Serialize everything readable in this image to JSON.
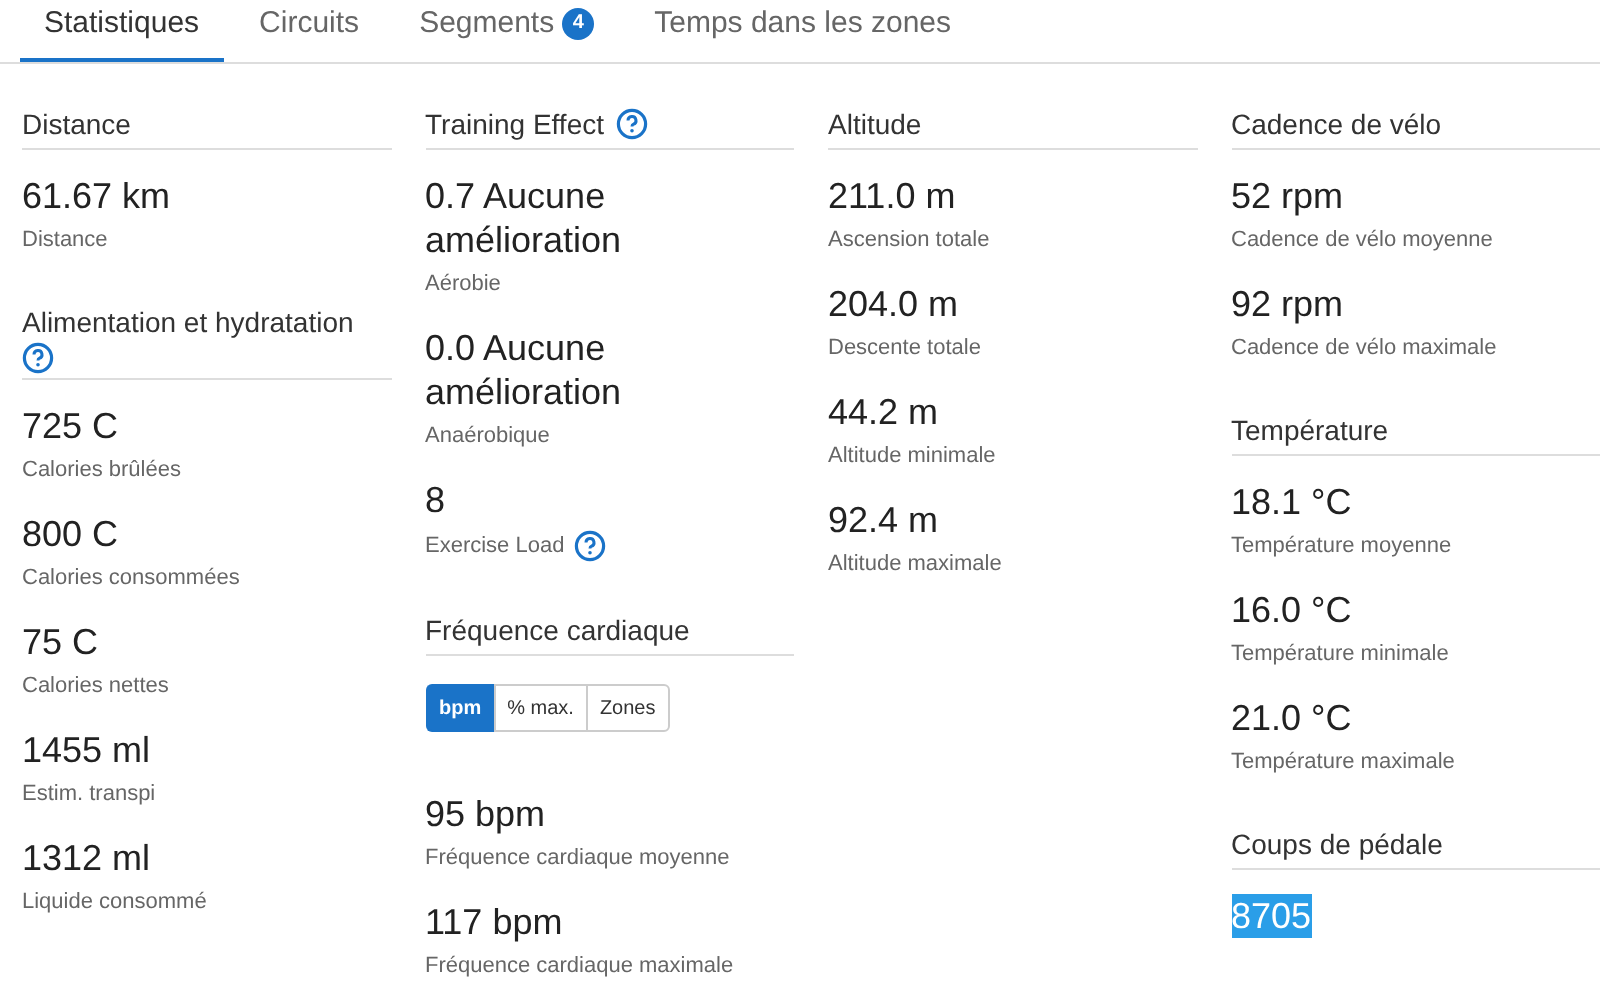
{
  "tabs": [
    {
      "label": "Statistiques",
      "selected": true
    },
    {
      "label": "Circuits",
      "selected": false
    },
    {
      "label": "Segments",
      "selected": false,
      "badge": "4"
    },
    {
      "label": "Temps dans les zones",
      "selected": false
    }
  ],
  "columns": [
    [
      {
        "title": "Distance",
        "items": [
          {
            "value": "61.67 km",
            "label": "Distance"
          }
        ]
      },
      {
        "title": "Alimentation et hydratation",
        "help": true,
        "items": [
          {
            "value": "725 C",
            "label": "Calories brûlées"
          },
          {
            "value": "800 C",
            "label": "Calories consommées"
          },
          {
            "value": "75 C",
            "label": "Calories nettes"
          },
          {
            "value": "1455 ml",
            "label": "Estim. transpi"
          },
          {
            "value": "1312 ml",
            "label": "Liquide consommé"
          }
        ]
      }
    ],
    [
      {
        "title": "Training Effect",
        "help": true,
        "items": [
          {
            "value": "0.7 Aucune amélioration",
            "label": "Aérobie"
          },
          {
            "value": "0.0 Aucune amélioration",
            "label": "Anaérobique"
          },
          {
            "value": "8",
            "label": "Exercise Load",
            "help": true
          }
        ]
      },
      {
        "title": "Fréquence cardiaque",
        "toggle": [
          {
            "label": "bpm",
            "selected": true
          },
          {
            "label": "% max.",
            "selected": false
          },
          {
            "label": "Zones",
            "selected": false
          }
        ],
        "items": [
          {
            "value": "95 bpm",
            "label": "Fréquence cardiaque moyenne"
          },
          {
            "value": "117 bpm",
            "label": "Fréquence cardiaque maximale"
          }
        ]
      }
    ],
    [
      {
        "title": "Altitude",
        "items": [
          {
            "value": "211.0 m",
            "label": "Ascension totale"
          },
          {
            "value": "204.0 m",
            "label": "Descente totale"
          },
          {
            "value": "44.2 m",
            "label": "Altitude minimale"
          },
          {
            "value": "92.4 m",
            "label": "Altitude maximale"
          }
        ]
      }
    ],
    [
      {
        "title": "Cadence de vélo",
        "items": [
          {
            "value": "52 rpm",
            "label": "Cadence de vélo moyenne"
          },
          {
            "value": "92 rpm",
            "label": "Cadence de vélo maximale"
          }
        ]
      },
      {
        "title": "Température",
        "items": [
          {
            "value": "18.1 °C",
            "label": "Température moyenne"
          },
          {
            "value": "16.0 °C",
            "label": "Température minimale"
          },
          {
            "value": "21.0 °C",
            "label": "Température maximale"
          }
        ]
      },
      {
        "title": "Coups de pédale",
        "items": [
          {
            "value": "8705",
            "highlighted": true
          }
        ]
      }
    ]
  ]
}
